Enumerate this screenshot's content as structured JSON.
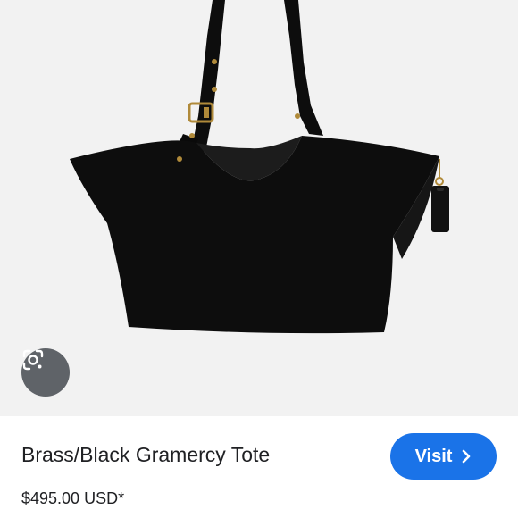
{
  "product": {
    "title": "Brass/Black Gramercy Tote",
    "price": "$495.00 USD*"
  },
  "actions": {
    "visit_label": "Visit",
    "visit_icon": "chevron-right-icon",
    "lens_icon": "google-lens-icon"
  },
  "colors": {
    "accent": "#1a73e8",
    "image_background": "#f2f2f2",
    "bag": "#0d0d0d",
    "hardware": "#b08a3a"
  }
}
